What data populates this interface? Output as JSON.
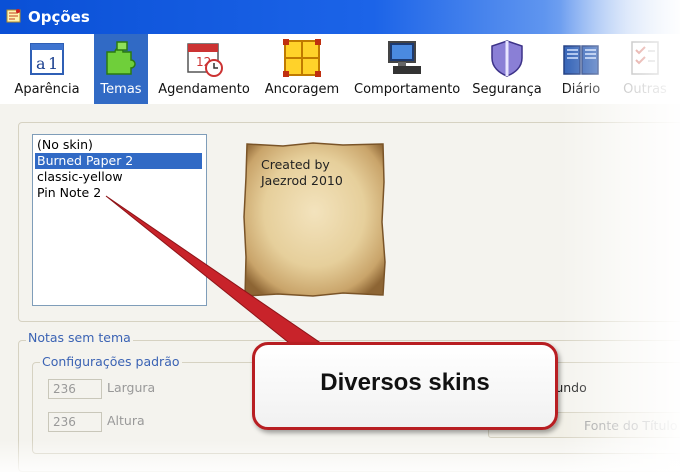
{
  "window": {
    "title": "Opções"
  },
  "toolbar": {
    "items": [
      {
        "label": "Aparência",
        "icon": "appearance-icon",
        "selected": false
      },
      {
        "label": "Temas",
        "icon": "puzzle-icon",
        "selected": true
      },
      {
        "label": "Agendamento",
        "icon": "calendar-clock-icon",
        "selected": false
      },
      {
        "label": "Ancoragem",
        "icon": "anchor-grid-icon",
        "selected": false
      },
      {
        "label": "Comportamento",
        "icon": "computer-icon",
        "selected": false
      },
      {
        "label": "Segurança",
        "icon": "shield-icon",
        "selected": false
      },
      {
        "label": "Diário",
        "icon": "book-icon",
        "selected": false
      },
      {
        "label": "Outras",
        "icon": "checklist-icon",
        "selected": false
      }
    ]
  },
  "themes": {
    "skins": [
      "(No skin)",
      "Burned Paper 2",
      "classic-yellow",
      "Pin Note 2"
    ],
    "selected": "Burned Paper 2",
    "preview_lines": [
      "Created by",
      "Jaezrod 2010"
    ]
  },
  "no_theme_notes": {
    "title": "Notas sem tema",
    "defaults_title": "Configurações padrão",
    "width_value": "236",
    "width_label": "Largura",
    "height_value": "236",
    "height_label": "Altura",
    "background_label": "Plano de  Fundo",
    "title_font_label": "Fonte do Título"
  },
  "callout": {
    "text": "Diversos skins",
    "border_color": "#b81e22"
  },
  "colors": {
    "selection": "#316ac5",
    "titlebar": "#0a50d6"
  }
}
